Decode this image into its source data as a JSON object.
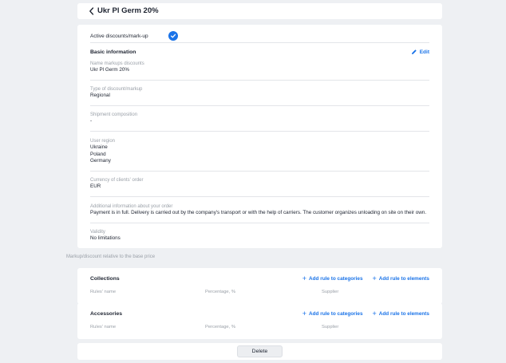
{
  "header": {
    "title": "Ukr Pl Germ 20%"
  },
  "active_toggle": {
    "label": "Active discounts/mark-up",
    "checked": true,
    "color": "#1a73e8"
  },
  "basic_info": {
    "title": "Basic information",
    "edit_label": "Edit",
    "fields": [
      {
        "label": "Name markups discounts",
        "lines": [
          "Ukr Pl Germ 20%"
        ]
      },
      {
        "label": "Type of discount/markup",
        "lines": [
          "Regional"
        ]
      },
      {
        "label": "Shipment composition",
        "lines": [
          "-"
        ]
      },
      {
        "label": "User region",
        "lines": [
          "Ukraine",
          "Poland",
          "Germany"
        ]
      },
      {
        "label": "Currency of clients' order",
        "lines": [
          "EUR"
        ]
      },
      {
        "label": "Additional information about your order",
        "lines": [
          "Payment is in full. Delivery is carried out by the company's transport or with the help of carriers. The customer organizes unloading on site on their own."
        ]
      },
      {
        "label": "Validity",
        "lines": [
          "No limitations"
        ]
      }
    ]
  },
  "rules_caption": "Markup/discount relative to the base price",
  "rule_sections": [
    {
      "title": "Collections",
      "add_categories": "Add rule to categories",
      "add_elements": "Add rule to elements",
      "columns": [
        "Rules' name",
        "Percentage, %",
        "Supplier"
      ]
    },
    {
      "title": "Accessories",
      "add_categories": "Add rule to categories",
      "add_elements": "Add rule to elements",
      "columns": [
        "Rules' name",
        "Percentage, %",
        "Supplier"
      ]
    }
  ],
  "delete_label": "Delete"
}
